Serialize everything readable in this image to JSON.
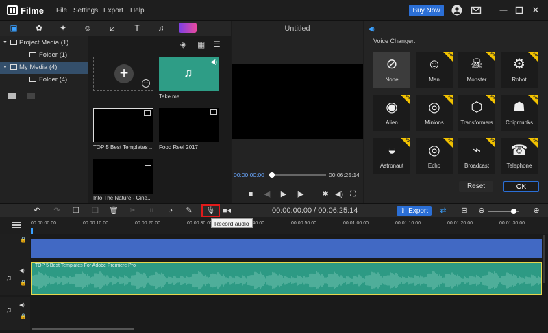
{
  "app": {
    "name": "Filme",
    "menu": [
      "File",
      "Settings",
      "Export",
      "Help"
    ],
    "buy_now": "Buy Now"
  },
  "tree": [
    {
      "label": "Project Media (1)",
      "level": 0
    },
    {
      "label": "Folder (1)",
      "level": 1
    },
    {
      "label": "My Media (4)",
      "level": 0,
      "selected": true
    },
    {
      "label": "Folder (4)",
      "level": 1
    }
  ],
  "media": [
    {
      "label": "",
      "type": "add"
    },
    {
      "label": "Take me",
      "type": "audio"
    },
    {
      "label": "TOP 5 Best Templates ...",
      "type": "video"
    },
    {
      "label": "Food Reel 2017",
      "type": "video"
    },
    {
      "label": "Into The Nature - Cine...",
      "type": "video"
    }
  ],
  "preview": {
    "title": "Untitled",
    "current_time": "00:00:00:00",
    "total_time": "00:06:25:14"
  },
  "voice_changer": {
    "title": "Voice Changer:",
    "options": [
      {
        "label": "None",
        "icon": "no-icon",
        "vip": false
      },
      {
        "label": "Man",
        "icon": "man-icon",
        "vip": true
      },
      {
        "label": "Monster",
        "icon": "monster-icon",
        "vip": true
      },
      {
        "label": "Robot",
        "icon": "robot-icon",
        "vip": true
      },
      {
        "label": "Alien",
        "icon": "alien-icon",
        "vip": true
      },
      {
        "label": "Minions",
        "icon": "minions-icon",
        "vip": true
      },
      {
        "label": "Transformers",
        "icon": "transformers-icon",
        "vip": true
      },
      {
        "label": "Chipmunks",
        "icon": "chipmunks-icon",
        "vip": true
      },
      {
        "label": "Astronaut",
        "icon": "astronaut-icon",
        "vip": true
      },
      {
        "label": "Echo",
        "icon": "echo-icon",
        "vip": true
      },
      {
        "label": "Broadcast",
        "icon": "broadcast-icon",
        "vip": true
      },
      {
        "label": "Telephone",
        "icon": "telephone-icon",
        "vip": true
      }
    ],
    "reset_label": "Reset",
    "ok_label": "OK",
    "vip_badge": "VIP"
  },
  "timeline": {
    "timecode": "00:00:00:00 / 00:06:25:14",
    "export_label": "Export",
    "tooltip": "Record audio",
    "ruler": [
      "00:00:00:00",
      "00:00:10:00",
      "00:00:20:00",
      "00:00:30:00",
      "00:00:40:00",
      "00:00:50:00",
      "00:01:00:00",
      "00:01:10:00",
      "00:01:20:00",
      "00:01:30:00"
    ],
    "audio_clip_title": "TOP 5 Best Templates For Adobe Premiere Pro"
  },
  "colors": {
    "accent": "#2b6fd6",
    "audio_clip": "#2d9a84",
    "video_clip": "#4169c4",
    "vip": "#f2c200",
    "highlight": "#e01b1b"
  }
}
